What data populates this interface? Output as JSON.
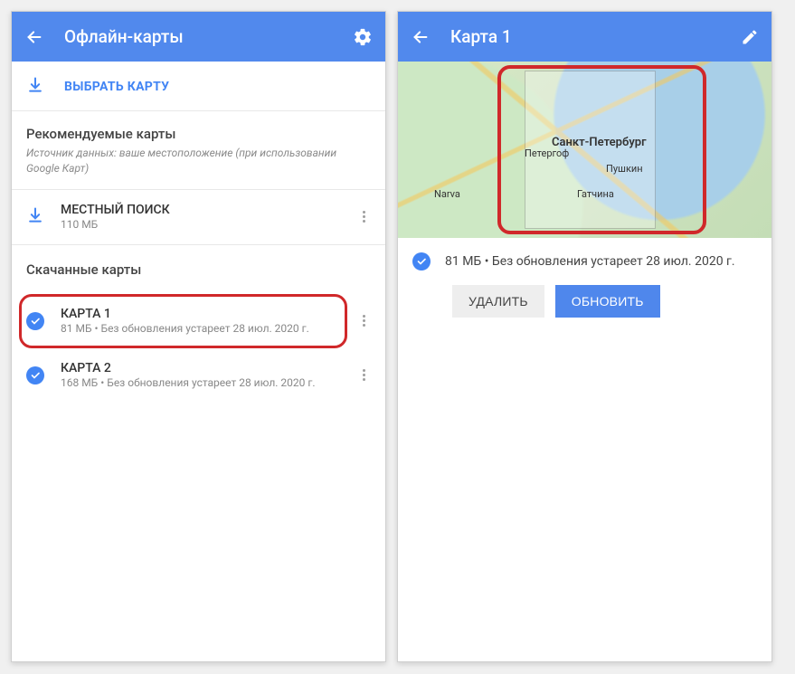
{
  "left": {
    "title": "Офлайн-карты",
    "select_map": "ВЫБРАТЬ КАРТУ",
    "recommended": {
      "heading": "Рекомендуемые карты",
      "subtitle": "Источник данных: ваше местоположение (при использовании Google Карт)",
      "item": {
        "name": "МЕСТНЫЙ ПОИСК",
        "meta": "110 МБ"
      }
    },
    "downloaded": {
      "heading": "Скачанные карты",
      "items": [
        {
          "name": "КАРТА 1",
          "meta": "81 МБ • Без обновления устареет 28 июл. 2020 г."
        },
        {
          "name": "КАРТА 2",
          "meta": "168 МБ • Без обновления устареет 28 июл. 2020 г."
        }
      ]
    }
  },
  "right": {
    "title": "Карта 1",
    "map_labels": {
      "spb": "Санкт-Петербург",
      "peterhof": "Петергоф",
      "pushkin": "Пушкин",
      "gatchina": "Гатчина",
      "narva": "Narva"
    },
    "info": "81 МБ • Без обновления устареет 28 июл. 2020 г.",
    "buttons": {
      "delete": "УДАЛИТЬ",
      "update": "ОБНОВИТЬ"
    }
  }
}
